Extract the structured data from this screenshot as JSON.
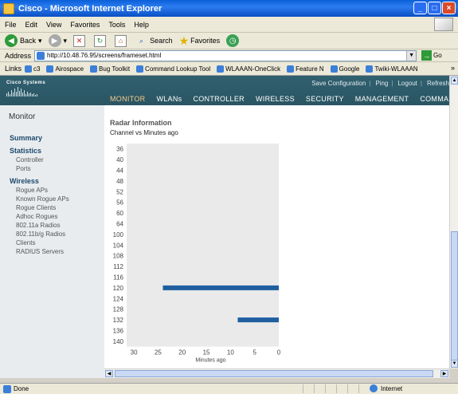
{
  "window": {
    "title": "Cisco - Microsoft Internet Explorer",
    "controls": {
      "minimize": "_",
      "maximize": "□",
      "close": "×"
    }
  },
  "menu": [
    "File",
    "Edit",
    "View",
    "Favorites",
    "Tools",
    "Help"
  ],
  "toolbar": {
    "back": "Back",
    "search": "Search",
    "favorites": "Favorites"
  },
  "address": {
    "label": "Address",
    "url": "http://10.48.76.95/screens/frameset.html",
    "go": "Go"
  },
  "links": {
    "label": "Links",
    "items": [
      "c3",
      "Airospace",
      "Bug Toolkit",
      "Command Lookup Tool",
      "WLAAAN-OneClick",
      "Feature N",
      "Google",
      "Twiki-WLAAAN"
    ],
    "more": "»"
  },
  "cisco": {
    "logo": "Cisco Systems",
    "top_links": [
      "Save Configuration",
      "Ping",
      "Logout",
      "Refresh"
    ],
    "tabs": [
      "MONITOR",
      "WLANs",
      "CONTROLLER",
      "WIRELESS",
      "SECURITY",
      "MANAGEMENT",
      "COMMANDS"
    ],
    "active_tab": "MONITOR"
  },
  "sidebar": {
    "title": "Monitor",
    "summary": "Summary",
    "statistics": {
      "label": "Statistics",
      "items": [
        "Controller",
        "Ports"
      ]
    },
    "wireless": {
      "label": "Wireless",
      "items": [
        "Rogue APs",
        "Known Rogue APs",
        "Rogue Clients",
        "Adhoc Rogues",
        "802.11a Radios",
        "802.11b/g Radios",
        "Clients",
        "RADIUS Servers"
      ]
    }
  },
  "main": {
    "title": "Radar Information",
    "subtitle": "Channel vs Minutes ago"
  },
  "chart_data": {
    "type": "bar",
    "orientation": "horizontal",
    "categories": [
      "36",
      "40",
      "44",
      "48",
      "52",
      "56",
      "60",
      "64",
      "100",
      "104",
      "108",
      "112",
      "116",
      "120",
      "124",
      "128",
      "132",
      "136",
      "140"
    ],
    "series": [
      {
        "values": [
          null,
          null,
          null,
          null,
          null,
          null,
          null,
          null,
          null,
          null,
          null,
          null,
          null,
          [
            0,
            24
          ],
          null,
          null,
          [
            0,
            8.5
          ],
          null,
          null
        ]
      }
    ],
    "xlabel": "Minutes ago",
    "ylabel": "",
    "xticks": [
      30,
      25,
      20,
      15,
      10,
      5,
      0
    ],
    "xlim": [
      31.5,
      0
    ],
    "reversed_x": true,
    "bar_color": "#1f5fa0",
    "plot_bg": "#eaeaea",
    "grid": false
  },
  "status": {
    "text": "Done",
    "zone": "Internet"
  }
}
